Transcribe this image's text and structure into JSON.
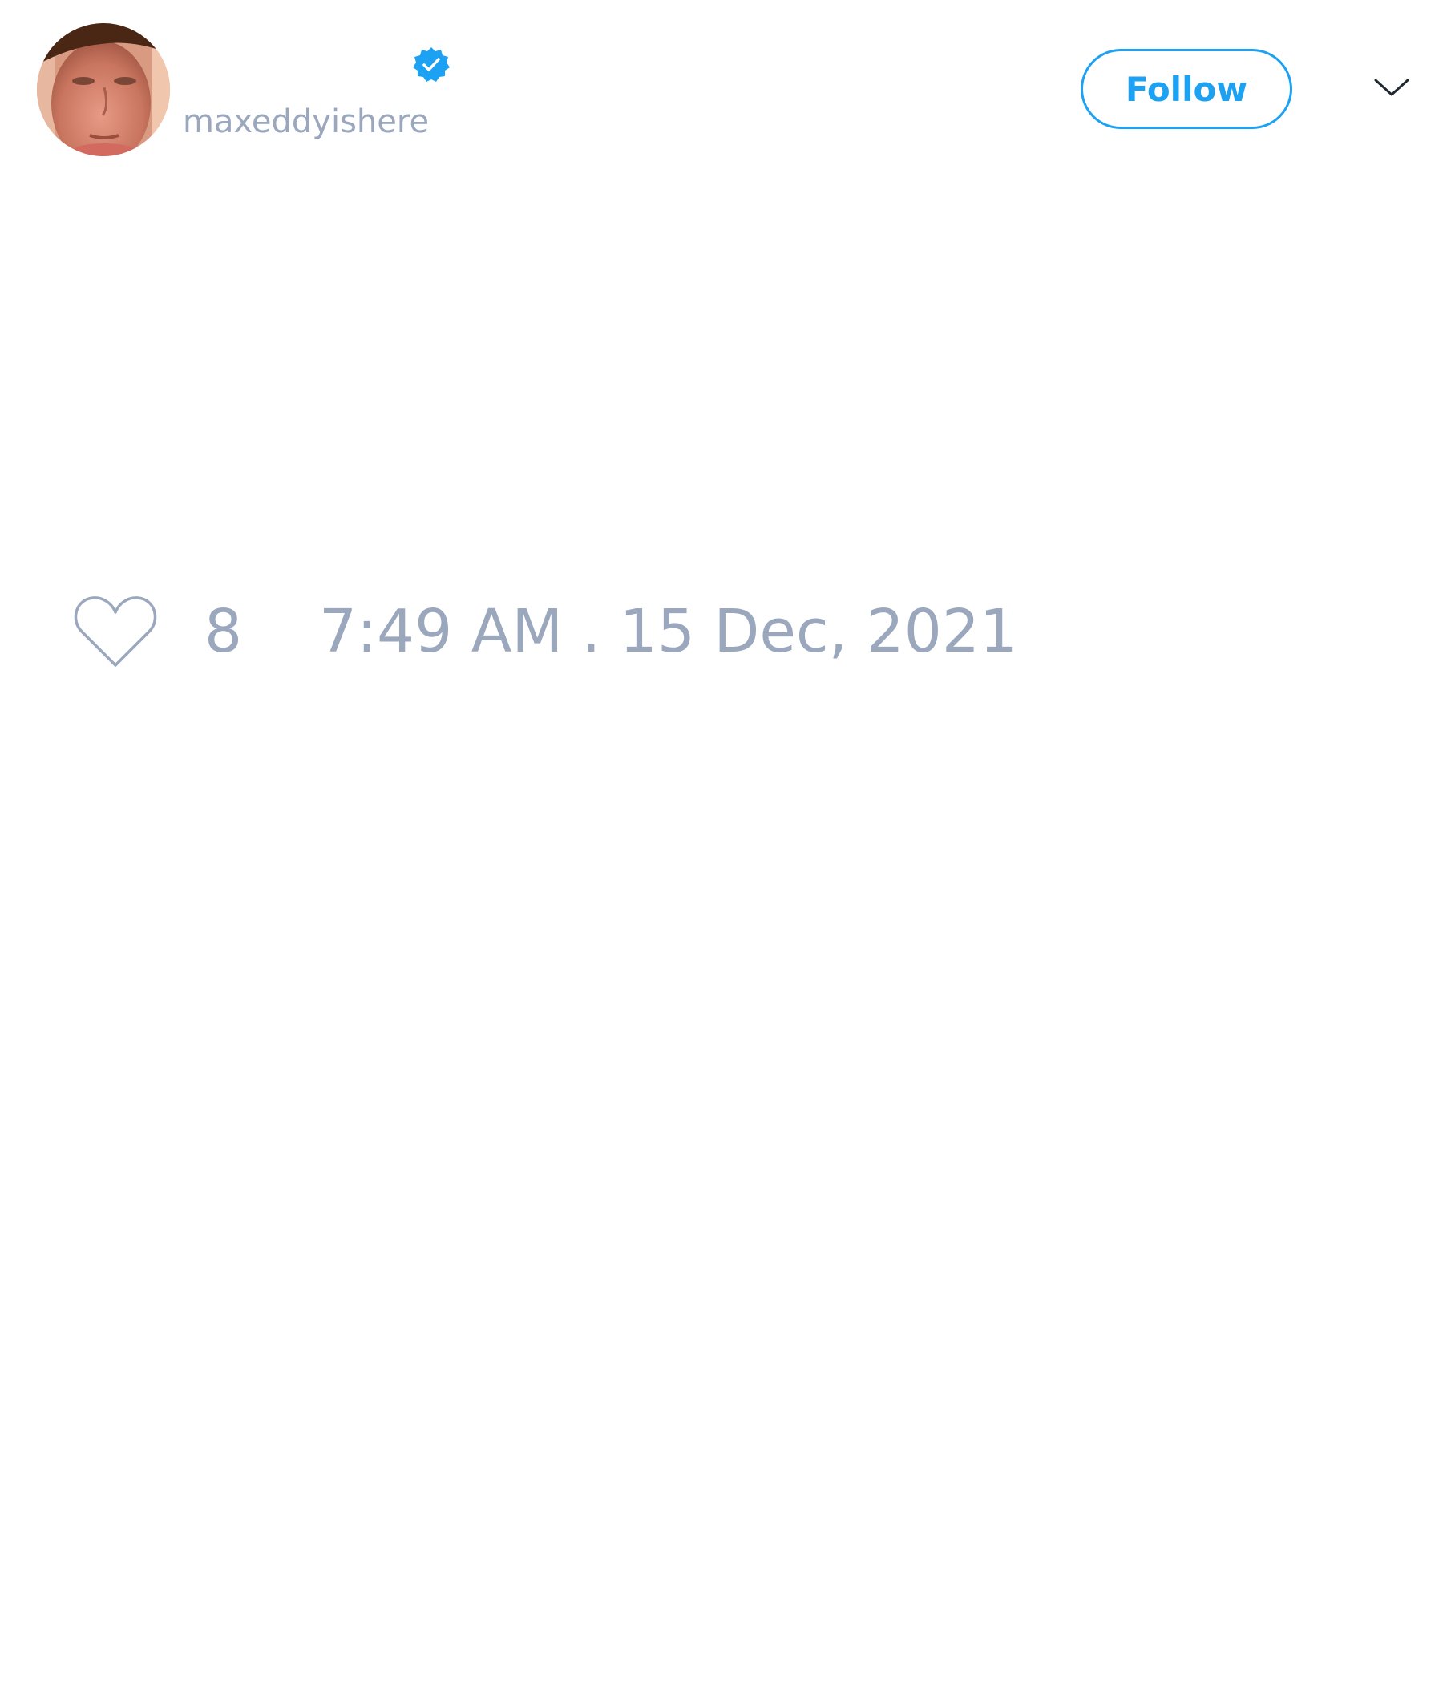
{
  "author": {
    "display_name": "",
    "handle": "maxeddyishere",
    "verified": true,
    "verified_icon": "verified-badge-icon",
    "avatar_icon": "profile-avatar"
  },
  "actions": {
    "follow_label": "Follow",
    "menu_icon": "chevron-down-icon"
  },
  "tweet": {
    "like_icon": "heart-outline-icon",
    "like_count": "8",
    "timestamp": "7:49 AM . 15 Dec, 2021"
  },
  "colors": {
    "accent": "#1da1f2",
    "muted_text": "#9aa7bc",
    "background": "#ffffff"
  }
}
